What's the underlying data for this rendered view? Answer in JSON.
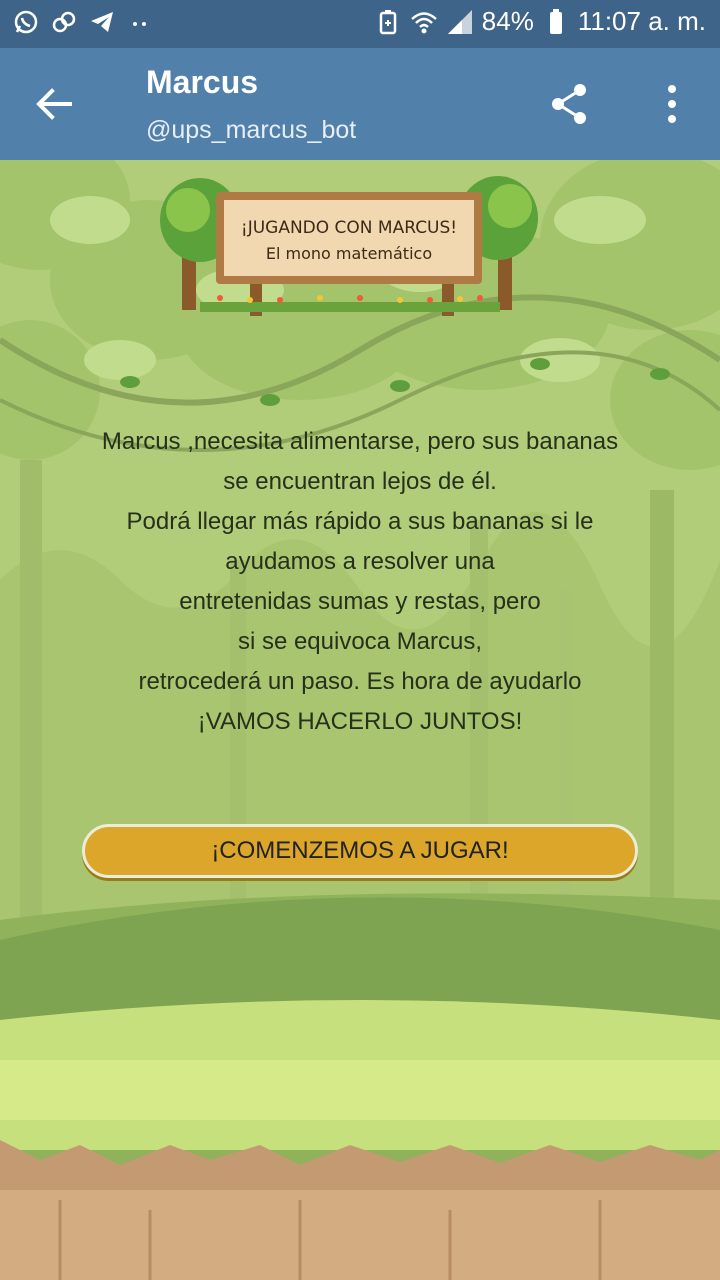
{
  "status_bar": {
    "battery": "84%",
    "time": "11:07 a. m.",
    "left_icons": [
      "whatsapp-icon",
      "link-icon",
      "telegram-icon",
      "more-dots-icon"
    ],
    "right_icons": [
      "battery-saver-icon",
      "wifi-icon",
      "signal-icon",
      "battery-icon"
    ]
  },
  "appbar": {
    "title": "Marcus",
    "subtitle": "@ups_marcus_bot",
    "icons": [
      "back-arrow-icon",
      "share-icon",
      "more-vert-icon"
    ]
  },
  "sign": {
    "line1": "¡JUGANDO CON MARCUS!",
    "line2": "El mono matemático"
  },
  "story": {
    "lines": [
      "Marcus ,necesita alimentarse, pero sus bananas",
      "se encuentran lejos de él.",
      "Podrá llegar más rápido a sus bananas si le",
      "ayudamos a resolver una",
      "entretenidas sumas y restas, pero",
      "si se equivoca Marcus,",
      "retrocederá un paso. Es hora de ayudarlo",
      "¡VAMOS HACERLO JUNTOS!"
    ]
  },
  "cta": {
    "label": "¡COMENZEMOS A JUGAR!"
  },
  "colors": {
    "status_bar": "#3f6489",
    "appbar": "#5180aa",
    "button": "#dca62a"
  }
}
